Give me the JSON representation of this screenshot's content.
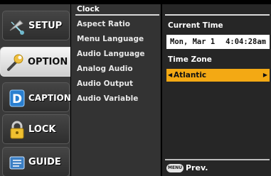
{
  "sidebar": {
    "tabs": [
      {
        "label": "SETUP",
        "icon": "satellite-dish-icon",
        "active": false
      },
      {
        "label": "OPTION",
        "icon": "wrench-icon",
        "active": true
      },
      {
        "label": "CAPTION",
        "icon": "caption-d-icon",
        "active": false
      },
      {
        "label": "LOCK",
        "icon": "padlock-icon",
        "active": false
      },
      {
        "label": "GUIDE",
        "icon": "guide-book-icon",
        "active": false
      }
    ]
  },
  "menu": {
    "items": [
      {
        "label": "Clock",
        "selected": true
      },
      {
        "label": "Aspect Ratio",
        "selected": false
      },
      {
        "label": "Menu Language",
        "selected": false
      },
      {
        "label": "Audio Language",
        "selected": false
      },
      {
        "label": "Analog Audio",
        "selected": false
      },
      {
        "label": "Audio Output",
        "selected": false
      },
      {
        "label": "Audio Variable",
        "selected": false
      }
    ]
  },
  "panel": {
    "current_time_heading": "Current Time",
    "current_date": "Mon, Mar 1",
    "current_clock": "4:04:28am",
    "time_zone_heading": "Time Zone",
    "time_zone_value": "Atlantic",
    "time_zone_left_arrow": "◀",
    "time_zone_right_arrow": "▶",
    "highlight_color": "#f3a914"
  },
  "footer": {
    "menu_button_label": "MENU",
    "prev_label": "Prev."
  }
}
